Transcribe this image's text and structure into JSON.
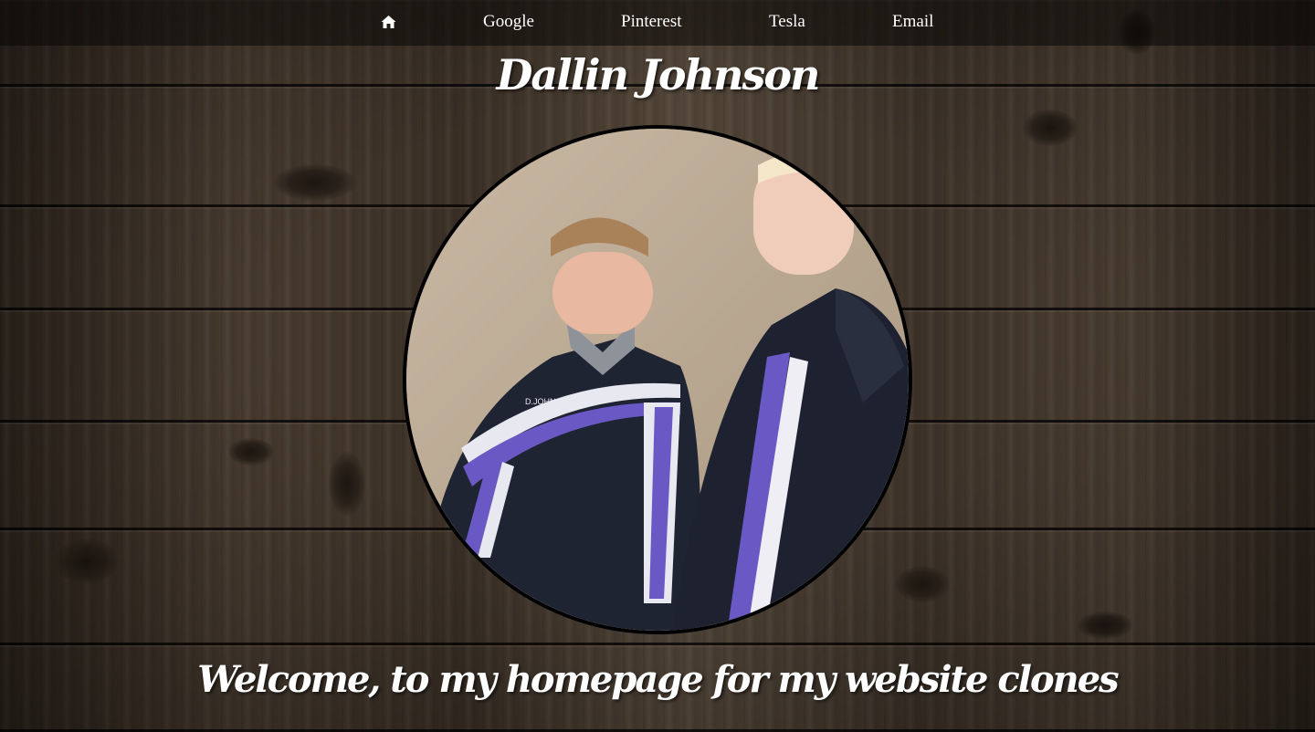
{
  "nav": {
    "home_icon": "home-icon",
    "items": [
      {
        "label": "Google"
      },
      {
        "label": "Pinterest"
      },
      {
        "label": "Tesla"
      },
      {
        "label": "Email"
      }
    ]
  },
  "header": {
    "title": "Dallin Johnson"
  },
  "portrait": {
    "alt": "Two young men in matching dark team jackets standing against a stucco wall",
    "jacket_text": "D.JOHNSON"
  },
  "main": {
    "welcome": "Welcome, to my homepage for my website clones"
  },
  "colors": {
    "nav_background": "#0a0806",
    "text": "#ffffff",
    "portrait_border": "#000000",
    "wood_dark": "#2f261e",
    "wood_light": "#54473a"
  }
}
